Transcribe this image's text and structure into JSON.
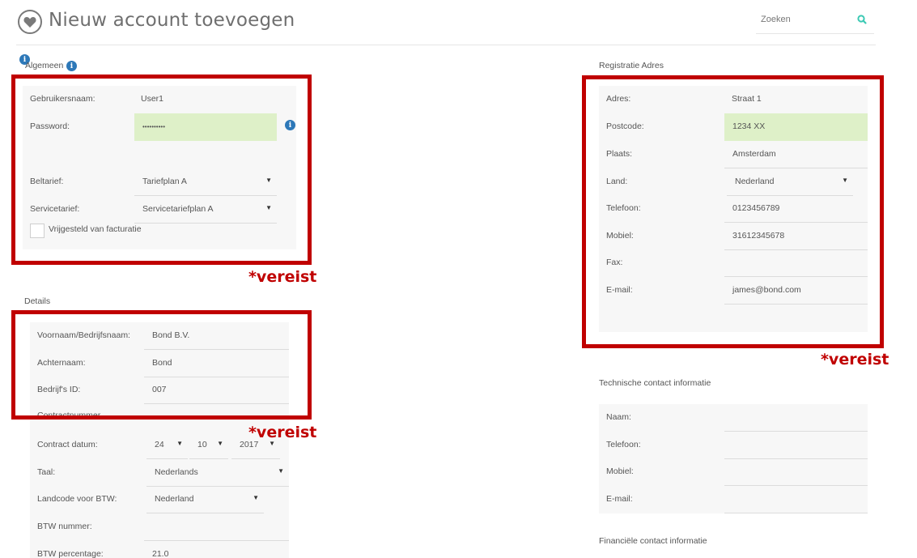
{
  "header": {
    "title": "Nieuw account toevoegen",
    "search_placeholder": "Zoeken"
  },
  "algemeen": {
    "section_title": "Algemeen",
    "username_label": "Gebruikersnaam:",
    "username_value": "User1",
    "password_label": "Password:",
    "password_value": "••••••••••",
    "beltarief_label": "Beltarief:",
    "beltarief_value": "Tariefplan A",
    "servicetarief_label": "Servicetarief:",
    "servicetarief_value": "Servicetariefplan A",
    "exempt_label": "Vrijgesteld van facturatie",
    "required_note": "*vereist"
  },
  "details": {
    "section_title": "Details",
    "first_name_label": "Voornaam/Bedrijfsnaam:",
    "first_name_value": "Bond B.V.",
    "last_name_label": "Achternaam:",
    "last_name_value": "Bond",
    "company_id_label": "Bedrijf's ID:",
    "company_id_value": "007",
    "contract_hidden_label": "Contractnummer",
    "contract_date_label": "Contract datum:",
    "contract_day": "24",
    "contract_month": "10",
    "contract_year": "2017",
    "language_label": "Taal:",
    "language_value": "Nederlands",
    "vat_country_label": "Landcode voor BTW:",
    "vat_country_value": "Nederland",
    "vat_number_label": "BTW nummer:",
    "vat_number_value": "",
    "vat_percentage_label": "BTW percentage:",
    "vat_percentage_value": "21.0",
    "required_note": "*vereist"
  },
  "registration": {
    "section_title": "Registratie Adres",
    "address_label": "Adres:",
    "address_value": "Straat 1",
    "postcode_label": "Postcode:",
    "postcode_value": "1234 XX",
    "city_label": "Plaats:",
    "city_value": "Amsterdam",
    "country_label": "Land:",
    "country_value": "Nederland",
    "phone_label": "Telefoon:",
    "phone_value": "0123456789",
    "mobile_label": "Mobiel:",
    "mobile_value": "31612345678",
    "fax_label": "Fax:",
    "fax_value": "",
    "email_label": "E-mail:",
    "email_value": "james@bond.com",
    "required_note": "*vereist"
  },
  "technical_contact": {
    "section_title": "Technische contact informatie",
    "name_label": "Naam:",
    "phone_label": "Telefoon:",
    "mobile_label": "Mobiel:",
    "email_label": "E-mail:"
  },
  "financial_contact": {
    "section_title": "Financiële contact informatie"
  },
  "colors": {
    "highlight_red": "#c00000",
    "valid_green": "#def0c8",
    "info_blue": "#2d78b8",
    "search_icon_teal": "#3cc9b4"
  }
}
